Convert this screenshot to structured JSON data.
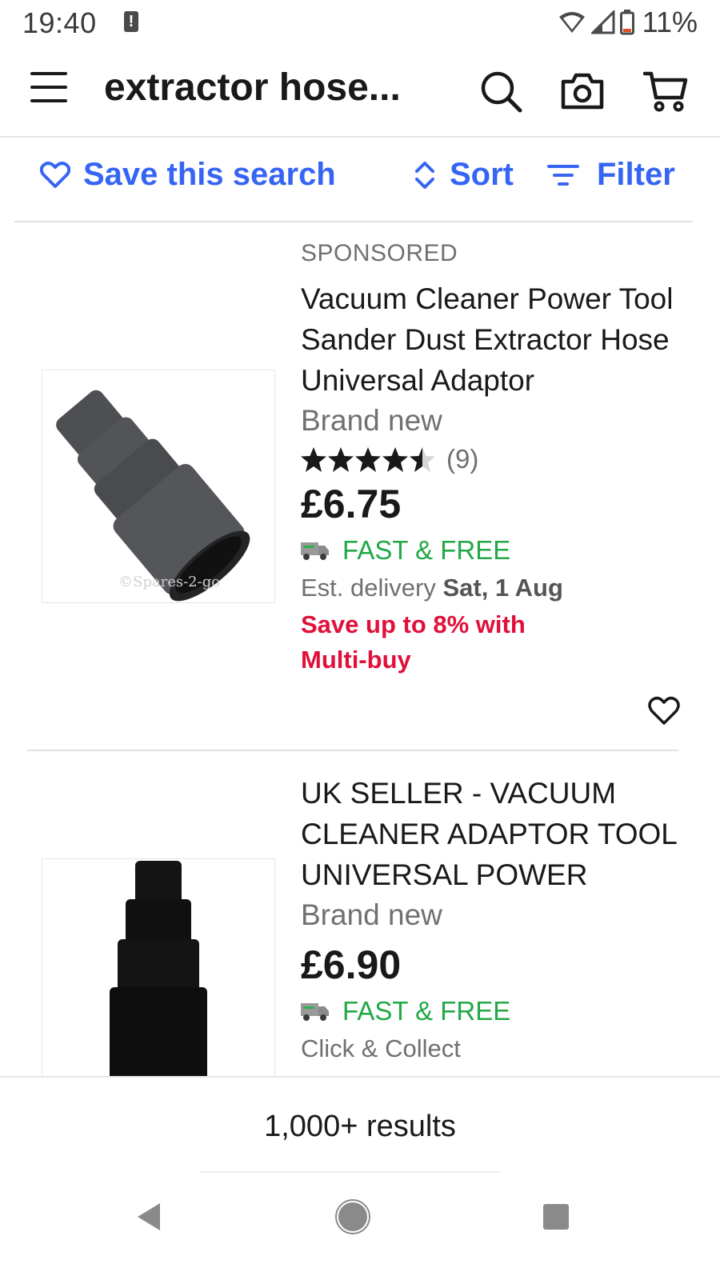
{
  "status_bar": {
    "time": "19:40",
    "alert_glyph": "!",
    "battery_percent": "11%",
    "icons": [
      "alert-icon",
      "wifi-icon",
      "signal-icon",
      "battery-icon"
    ]
  },
  "header": {
    "query": "extractor hose...",
    "icons": [
      "menu-icon",
      "search-icon",
      "camera-icon",
      "cart-icon"
    ]
  },
  "actions": {
    "save_search": "Save this search",
    "sort": "Sort",
    "filter": "Filter",
    "accent_color": "#3665f3"
  },
  "listings": [
    {
      "sponsored": "SPONSORED",
      "title": "Vacuum Cleaner Power Tool Sander Dust Extractor Hose Universal Adaptor",
      "condition": "Brand new",
      "rating": 4.5,
      "rating_count": "(9)",
      "price": "£6.75",
      "shipping": "FAST & FREE",
      "delivery_prefix": "Est. delivery",
      "delivery_date": "Sat, 1 Aug",
      "promo": "Save up to 8% with Multi-buy",
      "image_watermark": "©Spares-2-go"
    },
    {
      "title": "UK SELLER - VACUUM CLEANER ADAPTOR TOOL UNIVERSAL POWER",
      "condition": "Brand new",
      "price": "£6.90",
      "shipping": "FAST & FREE",
      "delivery": "Click & Collect"
    }
  ],
  "footer": {
    "results": "1,000+ results"
  },
  "colors": {
    "shipping_green": "#22a846",
    "promo_red": "#e0103a"
  }
}
